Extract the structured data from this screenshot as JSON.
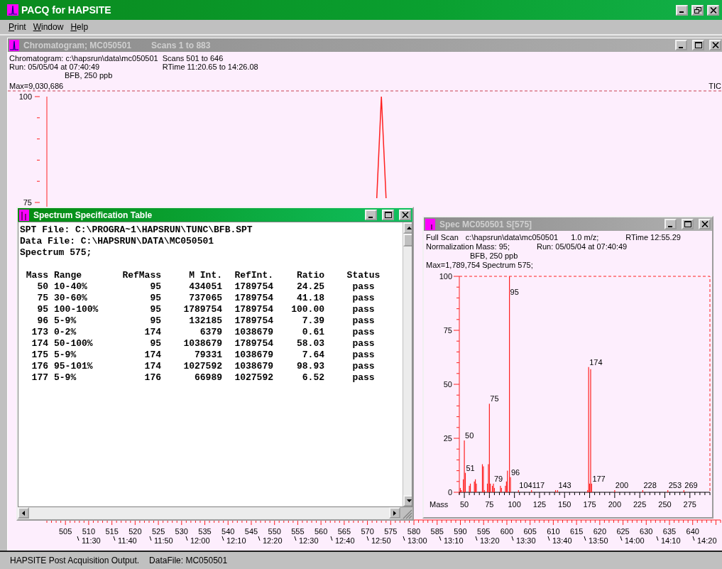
{
  "app": {
    "title": "PACQ for HAPSITE"
  },
  "menu": [
    "Print",
    "Window",
    "Help"
  ],
  "chromatogram_window": {
    "title": "Chromatogram; MC050501",
    "subtitle": "Scans 1 to 883",
    "active": false,
    "info_rows": [
      [
        "Chromatogram: c:\\hapsrun\\data\\mc050501",
        "Scans  501 to 646"
      ],
      [
        "Run: 05/05/04 at 07:40:49",
        "RTime 11:20.65 to 14:26.08"
      ]
    ],
    "sample": "BFB, 250 ppb",
    "max": "Max=9,030,686",
    "chart_data": {
      "type": "line",
      "x": [
        572,
        573,
        574
      ],
      "series": [
        {
          "name": "TIC",
          "color": "#ff2020",
          "values": [
            76,
            100,
            76
          ]
        }
      ],
      "xlim": [
        501,
        646
      ],
      "ylim": [
        0,
        100
      ],
      "xticks": [
        505,
        510,
        515,
        520,
        525,
        530,
        535,
        540,
        545,
        550,
        555,
        560,
        565,
        570,
        575,
        580,
        585,
        590,
        595,
        600,
        605,
        610,
        615,
        620,
        625,
        630,
        635,
        640
      ],
      "yticks": [
        75,
        100
      ]
    },
    "time_labels": [
      "11:30",
      "11:40",
      "11:50",
      "12:00",
      "12:10",
      "12:20",
      "12:30",
      "12:40",
      "12:50",
      "13:00",
      "13:10",
      "13:20",
      "13:30",
      "13:40",
      "13:50",
      "14:00",
      "14:10",
      "14:20"
    ]
  },
  "spec_table_window": {
    "title": "Spectrum Specification Table",
    "active": true,
    "lines": [
      "SPT File: C:\\PROGRA~1\\HAPSRUN\\TUNC\\BFB.SPT",
      "Data File: C:\\HAPSRUN\\DATA\\MC050501",
      "Spectrum 575;"
    ],
    "columns": [
      "Mass",
      "Range",
      "RefMass",
      "M Int.",
      "RefInt.",
      "Ratio",
      "Status"
    ],
    "rows": [
      [
        "50",
        "10-40%",
        "95",
        "434051",
        "1789754",
        "24.25",
        "pass"
      ],
      [
        "75",
        "30-60%",
        "95",
        "737065",
        "1789754",
        "41.18",
        "pass"
      ],
      [
        "95",
        "100-100%",
        "95",
        "1789754",
        "1789754",
        "100.00",
        "pass"
      ],
      [
        "96",
        "5-9%",
        "95",
        "132185",
        "1789754",
        "7.39",
        "pass"
      ],
      [
        "173",
        "0-2%",
        "174",
        "6379",
        "1038679",
        "0.61",
        "pass"
      ],
      [
        "174",
        "50-100%",
        "95",
        "1038679",
        "1789754",
        "58.03",
        "pass"
      ],
      [
        "175",
        "5-9%",
        "174",
        "79331",
        "1038679",
        "7.64",
        "pass"
      ],
      [
        "176",
        "95-101%",
        "174",
        "1027592",
        "1038679",
        "98.93",
        "pass"
      ],
      [
        "177",
        "5-9%",
        "176",
        "66989",
        "1027592",
        "6.52",
        "pass"
      ]
    ]
  },
  "spectrum_window": {
    "title": "Spec MC050501 S[575]",
    "active": false,
    "info_rows": [
      [
        "Full Scan",
        "c:\\hapsrun\\data\\mc050501",
        "1.0 m/z;",
        "RTime 12:55.29"
      ],
      [
        "Normalization Mass: 95;",
        "Run: 05/05/04 at 07:40:49"
      ]
    ],
    "sample": "BFB, 250 ppb",
    "max": "Max=1,789,754 Spectrum 575;",
    "chart_data": {
      "type": "bar",
      "xlabel": "Mass",
      "x": [
        46,
        47,
        49,
        50,
        51,
        55,
        56,
        60,
        61,
        62,
        68,
        69,
        70,
        73,
        74,
        75,
        76,
        78,
        79,
        80,
        86,
        87,
        91,
        92,
        93,
        95,
        96,
        104,
        117,
        141,
        143,
        173,
        174,
        175,
        176,
        177,
        200,
        228,
        253,
        269
      ],
      "series": [
        {
          "color": "#ff2020",
          "values": [
            2,
            1,
            6,
            24,
            9,
            3,
            4,
            5,
            6,
            4,
            13,
            12,
            1,
            4,
            13,
            41,
            4,
            3,
            4,
            2,
            3,
            2,
            3,
            5,
            10,
            100,
            7,
            1,
            1,
            1,
            1,
            1,
            58,
            4,
            57,
            4,
            1,
            1,
            1,
            1
          ]
        }
      ],
      "xlim": [
        45,
        295
      ],
      "ylim": [
        0,
        100
      ],
      "xticks": [
        50,
        75,
        100,
        125,
        150,
        175,
        200,
        225,
        250,
        275
      ],
      "yticks": [
        0,
        25,
        50,
        75,
        100
      ],
      "annotations": [
        {
          "x": 50,
          "y": 24,
          "text": "50"
        },
        {
          "x": 51,
          "y": 9,
          "text": "51"
        },
        {
          "x": 75,
          "y": 41,
          "text": "75"
        },
        {
          "x": 79,
          "y": 4,
          "text": "79"
        },
        {
          "x": 95,
          "y": 100,
          "text": "95"
        },
        {
          "x": 96,
          "y": 7,
          "text": "96"
        },
        {
          "x": 104,
          "y": 1,
          "text": "104"
        },
        {
          "x": 117,
          "y": 1,
          "text": "117"
        },
        {
          "x": 143,
          "y": 1,
          "text": "143"
        },
        {
          "x": 174,
          "y": 58,
          "text": "174"
        },
        {
          "x": 177,
          "y": 4,
          "text": "177"
        },
        {
          "x": 200,
          "y": 1,
          "text": "200"
        },
        {
          "x": 228,
          "y": 1,
          "text": "228"
        },
        {
          "x": 253,
          "y": 1,
          "text": "253"
        },
        {
          "x": 269,
          "y": 1,
          "text": "269"
        }
      ]
    }
  },
  "status_bar": [
    "HAPSITE Post Acquisition Output.",
    "DataFile: MC050501"
  ]
}
